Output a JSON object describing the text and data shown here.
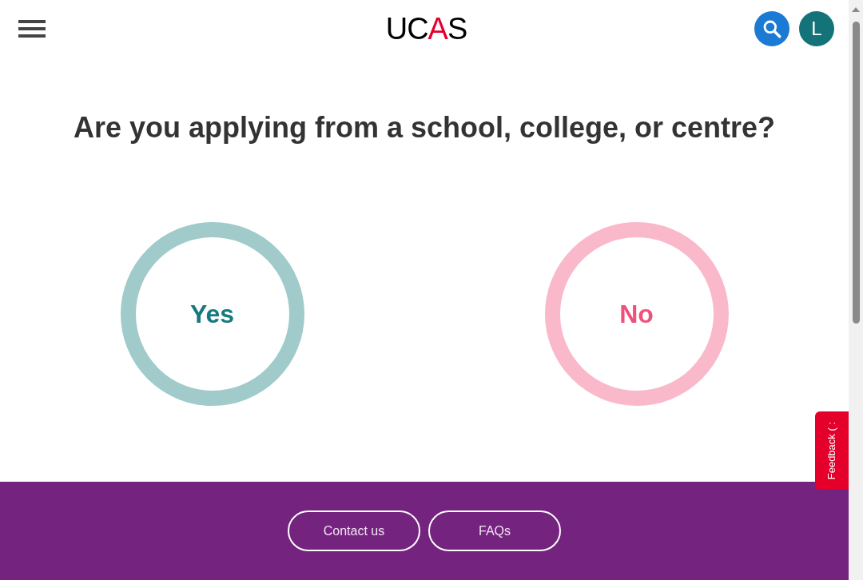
{
  "header": {
    "logo": [
      {
        "text": "UC",
        "accent": false
      },
      {
        "text": "A",
        "accent": true
      },
      {
        "text": "S",
        "accent": false
      }
    ],
    "avatar": {
      "initial": "L"
    }
  },
  "question": {
    "title": "Are you applying from a school, college, or centre?",
    "options": [
      {
        "label": "Yes",
        "color": "#147a7e"
      },
      {
        "label": "No",
        "color": "#f0507c"
      }
    ]
  },
  "feedback_tab": {
    "label": "Feedback ( :"
  },
  "footer": {
    "links": [
      "Contact us",
      "FAQs"
    ]
  }
}
